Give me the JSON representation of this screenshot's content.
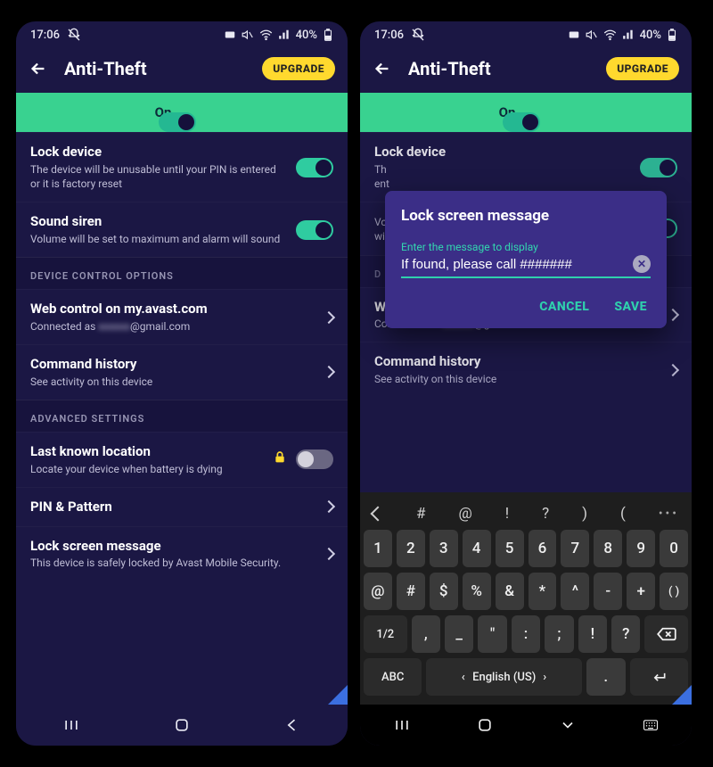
{
  "status": {
    "time": "17:06",
    "battery": "40%"
  },
  "header": {
    "title": "Anti-Theft",
    "upgrade": "UPGRADE"
  },
  "on_strip": {
    "label": "On"
  },
  "settings": {
    "lock_device": {
      "title": "Lock device",
      "sub": "The device will be unusable until your PIN is entered or it is factory reset"
    },
    "sound_siren": {
      "title": "Sound siren",
      "sub": "Volume will be set to maximum and alarm will sound"
    }
  },
  "sections": {
    "device_control": "DEVICE CONTROL OPTIONS",
    "advanced": "ADVANCED SETTINGS"
  },
  "web_control": {
    "title": "Web control on my.avast.com",
    "sub_prefix": "Connected as ",
    "sub_blurred": "xxxxxx",
    "sub_suffix": "@gmail.com"
  },
  "command_history": {
    "title": "Command history",
    "sub": "See activity on this device"
  },
  "last_known": {
    "title": "Last known location",
    "sub": "Locate your device when battery is dying"
  },
  "pin_pattern": {
    "title": "PIN & Pattern"
  },
  "lock_msg_row": {
    "title": "Lock screen message",
    "sub": "This device is safely locked by Avast Mobile Security."
  },
  "dialog": {
    "title": "Lock screen message",
    "label": "Enter the message to display",
    "value": "If found, please call #######",
    "cancel": "CANCEL",
    "save": "SAVE"
  },
  "keyboard": {
    "suggestions": [
      "#",
      "@",
      "!",
      "?",
      ")",
      "("
    ],
    "row1": [
      "1",
      "2",
      "3",
      "4",
      "5",
      "6",
      "7",
      "8",
      "9",
      "0"
    ],
    "row2": [
      "@",
      "#",
      "$",
      "%",
      "&",
      "*",
      "^",
      "-",
      "+",
      "( )"
    ],
    "row3_switch": "1/2",
    "row3": [
      ",",
      "_",
      "\"",
      ":",
      ";",
      "!",
      "?"
    ],
    "row4_abc": "ABC",
    "row4_lang": "English (US)",
    "row4_dot": "."
  }
}
